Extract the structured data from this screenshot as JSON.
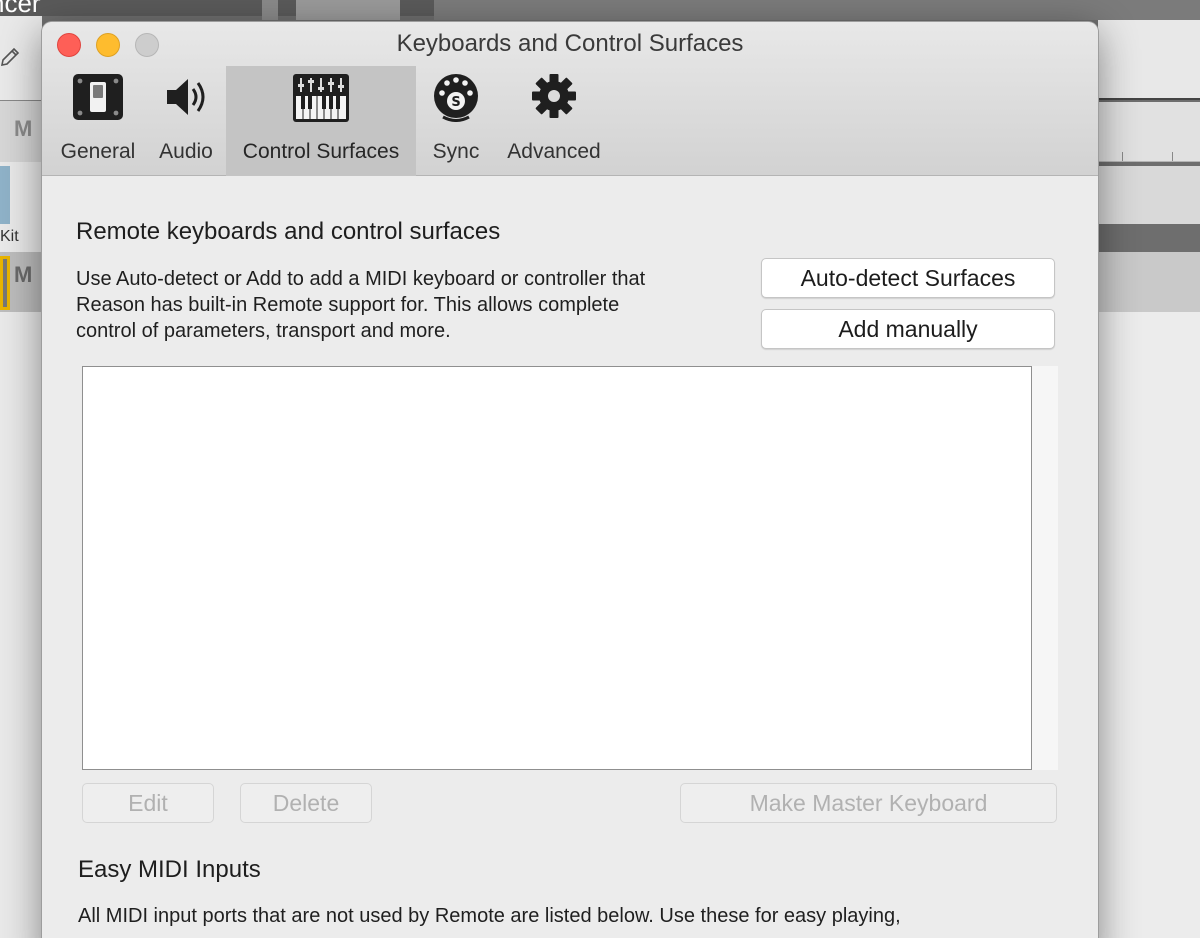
{
  "background": {
    "title_fragment": "ncer",
    "left_letter_1": "M",
    "left_label": "Kit",
    "left_letter_2": "M"
  },
  "window": {
    "title": "Keyboards and Control Surfaces",
    "tabs": [
      {
        "label": "General",
        "icon": "toggle-switch-icon",
        "active": false
      },
      {
        "label": "Audio",
        "icon": "speaker-icon",
        "active": false
      },
      {
        "label": "Control Surfaces",
        "icon": "keyboard-controller-icon",
        "active": true
      },
      {
        "label": "Sync",
        "icon": "midi-sync-icon",
        "active": false
      },
      {
        "label": "Advanced",
        "icon": "gear-icon",
        "active": false
      }
    ]
  },
  "remote": {
    "title": "Remote keyboards and control surfaces",
    "description_lines": [
      "Use Auto-detect or Add to add a MIDI keyboard or controller that",
      "Reason has built-in Remote support for. This allows complete",
      "control of parameters, transport and more."
    ],
    "autodetect_label": "Auto-detect Surfaces",
    "add_manually_label": "Add manually",
    "edit_label": "Edit",
    "delete_label": "Delete",
    "make_master_label": "Make Master Keyboard",
    "surfaces": []
  },
  "easy_midi": {
    "title": "Easy MIDI Inputs",
    "description": "All MIDI input ports that are not used by Remote are listed below. Use these for easy playing,"
  },
  "colors": {
    "close": "#fe5f57",
    "minimize": "#febc2e",
    "zoom": "#cdcdcd",
    "active_tab": "#c4c4c4"
  }
}
